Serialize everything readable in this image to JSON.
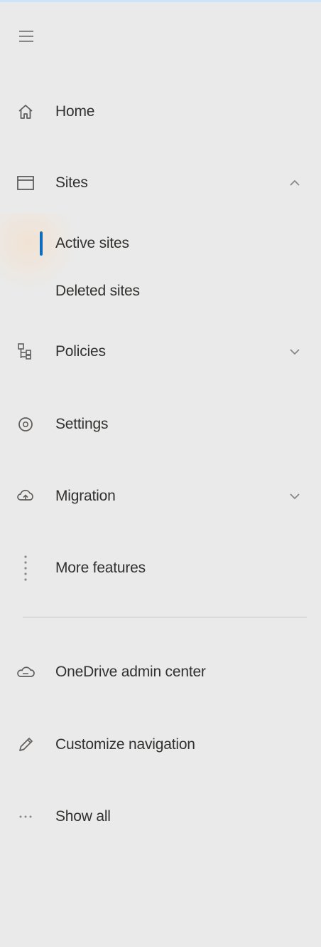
{
  "nav": {
    "items": [
      {
        "label": "Home",
        "icon": "home-icon"
      },
      {
        "label": "Sites",
        "icon": "sites-icon",
        "expanded": true
      },
      {
        "label": "Active sites",
        "selected": true
      },
      {
        "label": "Deleted sites"
      },
      {
        "label": "Policies",
        "icon": "policies-icon",
        "expanded": false
      },
      {
        "label": "Settings",
        "icon": "settings-icon"
      },
      {
        "label": "Migration",
        "icon": "migration-icon",
        "expanded": false
      },
      {
        "label": "More features",
        "icon": "more-features-icon"
      },
      {
        "label": "OneDrive admin center",
        "icon": "onedrive-icon"
      },
      {
        "label": "Customize navigation",
        "icon": "pencil-icon"
      },
      {
        "label": "Show all",
        "icon": "ellipsis-icon"
      }
    ]
  },
  "colors": {
    "background": "#eaeaea",
    "text": "#323130",
    "accent": "#0f6cbd"
  }
}
